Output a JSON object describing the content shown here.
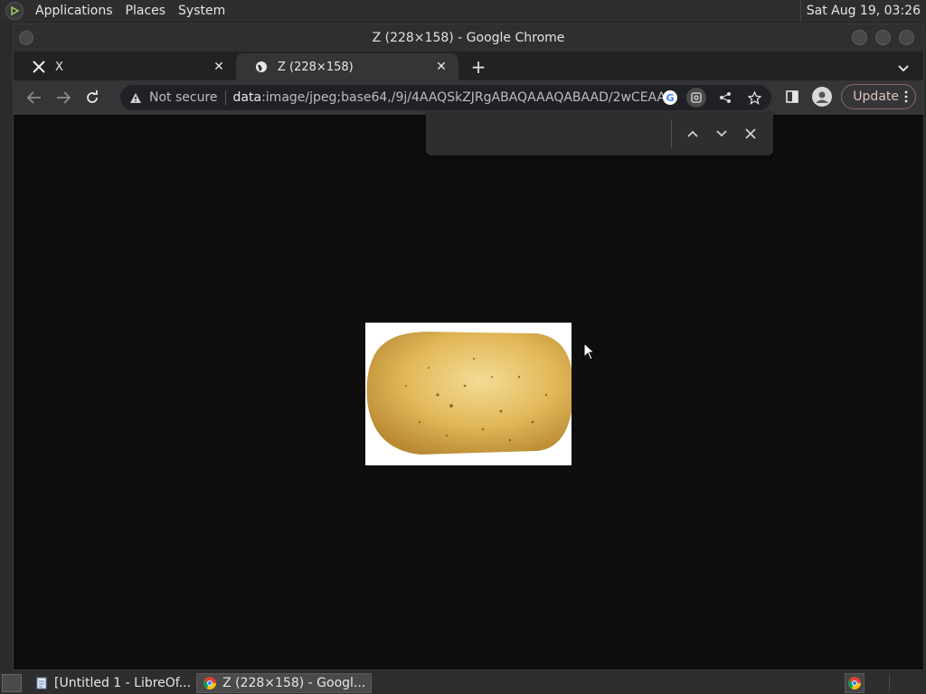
{
  "top_panel": {
    "menus": [
      "Applications",
      "Places",
      "System"
    ],
    "clock": "Sat Aug 19, 03:26"
  },
  "window": {
    "title": "Z (228×158) - Google Chrome"
  },
  "tabs": [
    {
      "title": "X",
      "icon": "x-logo-icon",
      "active": false
    },
    {
      "title": "Z (228×158)",
      "icon": "globe-icon",
      "active": true
    }
  ],
  "toolbar": {
    "security_label": "Not secure",
    "url_scheme": "data",
    "url_rest": ":image/jpeg;base64,/9j/4AAQSkZJRgABAQAAAQABAAD/2wCEAAkGB...",
    "update_label": "Update"
  },
  "find_bar": {
    "value": "",
    "placeholder": ""
  },
  "image": {
    "description_icon": "potato-image",
    "width": 228,
    "height": 158
  },
  "taskbar": {
    "tasks": [
      {
        "label": "[Untitled 1 - LibreOf...",
        "icon": "document-icon",
        "active": false
      },
      {
        "label": "Z (228×158) - Googl...",
        "icon": "chrome-icon",
        "active": true
      }
    ]
  },
  "colors": {
    "page_background": "#0e0e0f",
    "chrome_toolbar": "#353537",
    "potato": "#e2b95a"
  }
}
